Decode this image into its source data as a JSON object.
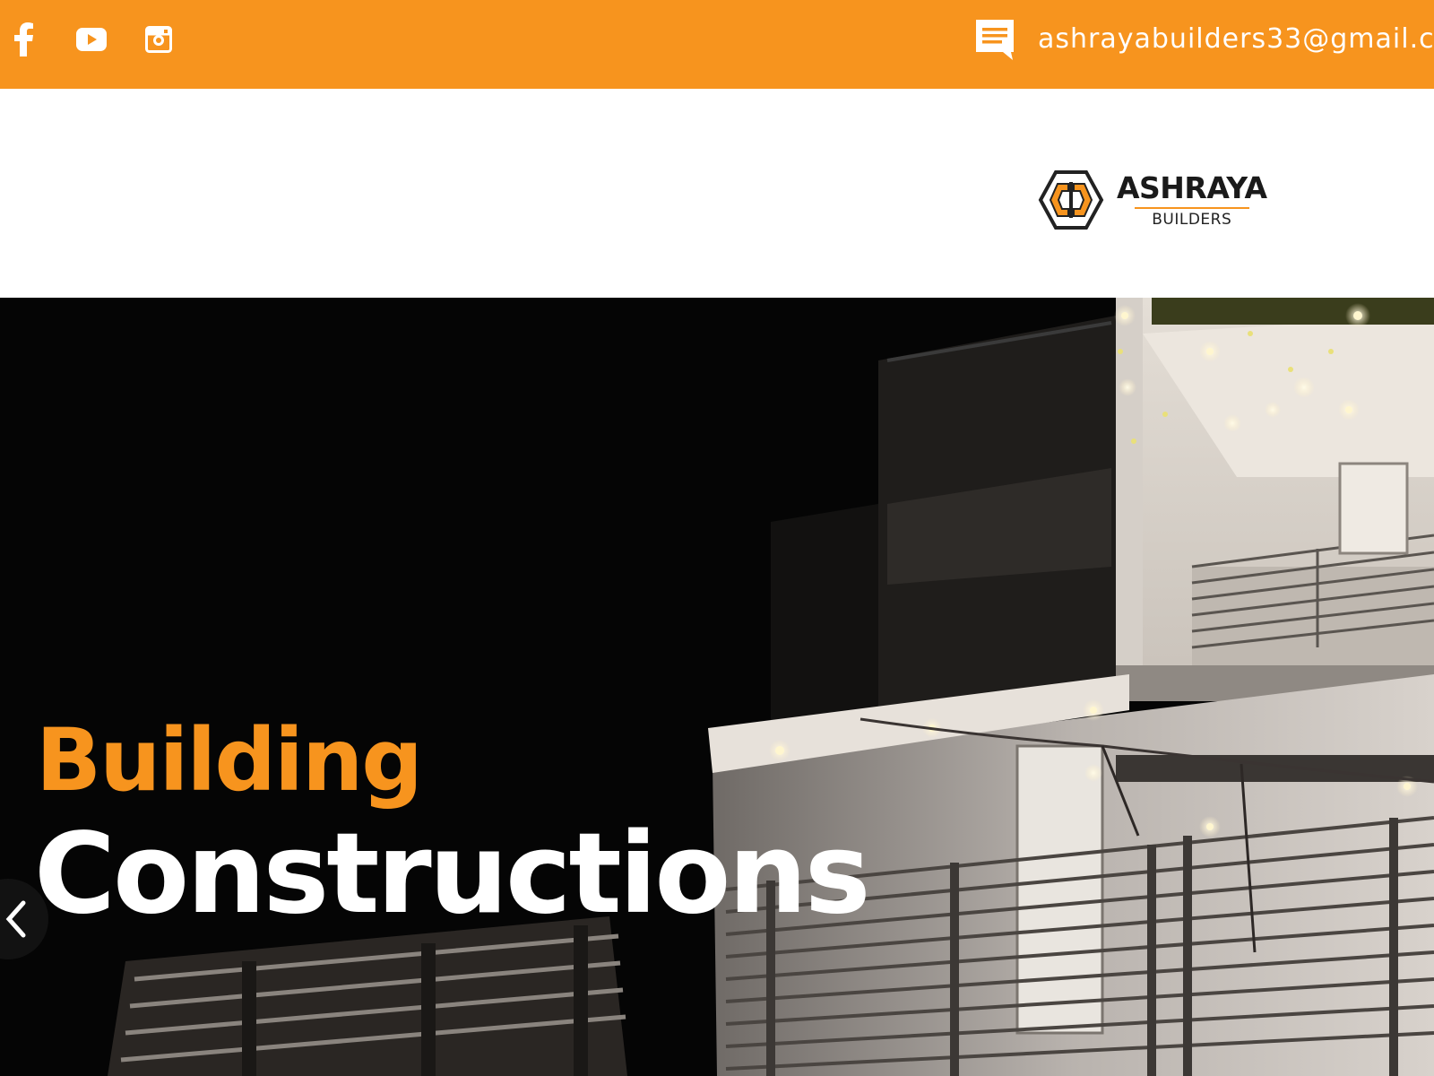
{
  "topbar": {
    "social": [
      {
        "name": "facebook-icon"
      },
      {
        "name": "youtube-icon"
      },
      {
        "name": "instagram-icon"
      }
    ],
    "contact_icon": "message-icon",
    "email": "ashrayabuilders33@gmail.c"
  },
  "header": {
    "logo_title": "ASHRAYA",
    "logo_subtitle": "BUILDERS"
  },
  "hero": {
    "heading": "Building",
    "subheading": "Constructions",
    "prev_icon": "chevron-left-icon"
  },
  "colors": {
    "accent": "#f7941e",
    "hero_text": "#ffffff",
    "hero_background": "#050505"
  }
}
